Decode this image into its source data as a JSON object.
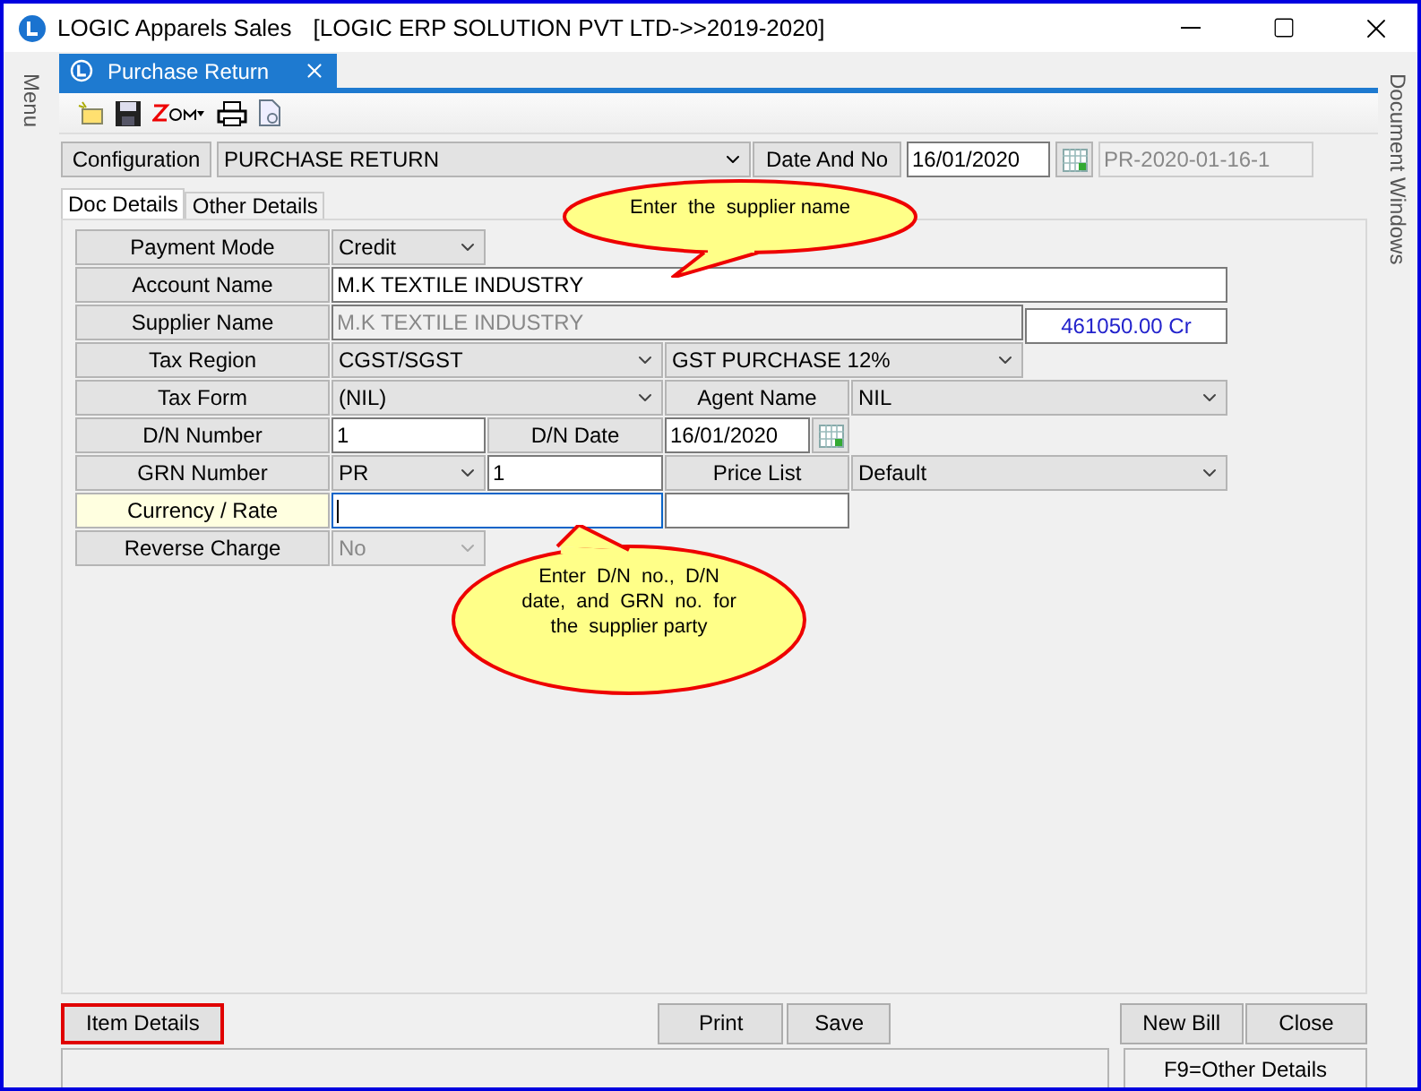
{
  "window": {
    "title": "LOGIC Apparels Sales",
    "subtitle": "[LOGIC ERP SOLUTION PVT LTD->>2019-2020]"
  },
  "side_panels": {
    "left": "Menu",
    "right": "Document Windows"
  },
  "document_tab": {
    "title": "Purchase Return"
  },
  "header": {
    "config_label": "Configuration",
    "config_value": "PURCHASE RETURN",
    "date_label": "Date And No",
    "date": "16/01/2020",
    "number": "PR-2020-01-16-1"
  },
  "tabs": [
    {
      "label": "Doc Details",
      "selected": true
    },
    {
      "label": "Other Details",
      "selected": false
    }
  ],
  "rows": [
    {
      "cells": [
        {
          "kind": "label",
          "text": "Payment Mode",
          "highlighted": false
        },
        {
          "kind": "select",
          "value": "Credit",
          "disabled": false
        }
      ]
    },
    {
      "cells": [
        {
          "kind": "label",
          "text": "Account Name",
          "highlighted": false
        },
        {
          "kind": "input",
          "value": "M.K TEXTILE INDUSTRY",
          "disabled": false,
          "focused": false
        }
      ]
    },
    {
      "cells": [
        {
          "kind": "label",
          "text": "Supplier Name",
          "highlighted": false
        },
        {
          "kind": "input",
          "value": "M.K TEXTILE INDUSTRY",
          "disabled": true,
          "focused": false
        },
        {
          "kind": "balance",
          "value": "461050.00 Cr"
        }
      ]
    },
    {
      "cells": [
        {
          "kind": "label",
          "text": "Tax Region",
          "highlighted": false
        },
        {
          "kind": "select",
          "value": "CGST/SGST",
          "disabled": false
        },
        {
          "kind": "select",
          "value": "GST PURCHASE 12%",
          "disabled": false
        }
      ]
    },
    {
      "cells": [
        {
          "kind": "label",
          "text": "Tax Form",
          "highlighted": false
        },
        {
          "kind": "select",
          "value": "(NIL)",
          "disabled": false
        },
        {
          "kind": "label",
          "text": "Agent Name",
          "highlighted": false
        },
        {
          "kind": "select",
          "value": "NIL",
          "disabled": false
        }
      ]
    },
    {
      "cells": [
        {
          "kind": "label",
          "text": "D/N Number",
          "highlighted": false
        },
        {
          "kind": "input",
          "value": "1",
          "disabled": false,
          "focused": false
        },
        {
          "kind": "label",
          "text": "D/N Date",
          "highlighted": false
        },
        {
          "kind": "date",
          "value": "16/01/2020"
        }
      ]
    },
    {
      "cells": [
        {
          "kind": "label",
          "text": "GRN Number",
          "highlighted": false
        },
        {
          "kind": "select",
          "value": "PR",
          "disabled": false
        },
        {
          "kind": "input",
          "value": "1",
          "disabled": false,
          "focused": false
        },
        {
          "kind": "label",
          "text": "Price List",
          "highlighted": false
        },
        {
          "kind": "select",
          "value": "Default",
          "disabled": false
        }
      ]
    },
    {
      "cells": [
        {
          "kind": "label",
          "text": "Currency / Rate",
          "highlighted": true
        },
        {
          "kind": "input",
          "disabled": false,
          "focused": true
        },
        {
          "kind": "input",
          "disabled": false,
          "focused": false
        }
      ]
    },
    {
      "cells": [
        {
          "kind": "label",
          "text": "Reverse Charge",
          "highlighted": false
        },
        {
          "kind": "select",
          "value": "No",
          "disabled": true
        }
      ]
    }
  ],
  "callouts": [
    "Enter  the  supplier name",
    "Enter  D/N  no.,  D/N date,  and  GRN  no.  for the  supplier party"
  ],
  "buttons": {
    "left": [
      {
        "label": "Item Details",
        "highlighted": true
      }
    ],
    "center": [
      {
        "label": "Print",
        "highlighted": false
      },
      {
        "label": "Save",
        "highlighted": false
      }
    ],
    "right": [
      {
        "label": "New Bill",
        "highlighted": false
      },
      {
        "label": "Close",
        "highlighted": false
      }
    ]
  },
  "status_bar": {
    "hint": "F9=Other Details"
  }
}
